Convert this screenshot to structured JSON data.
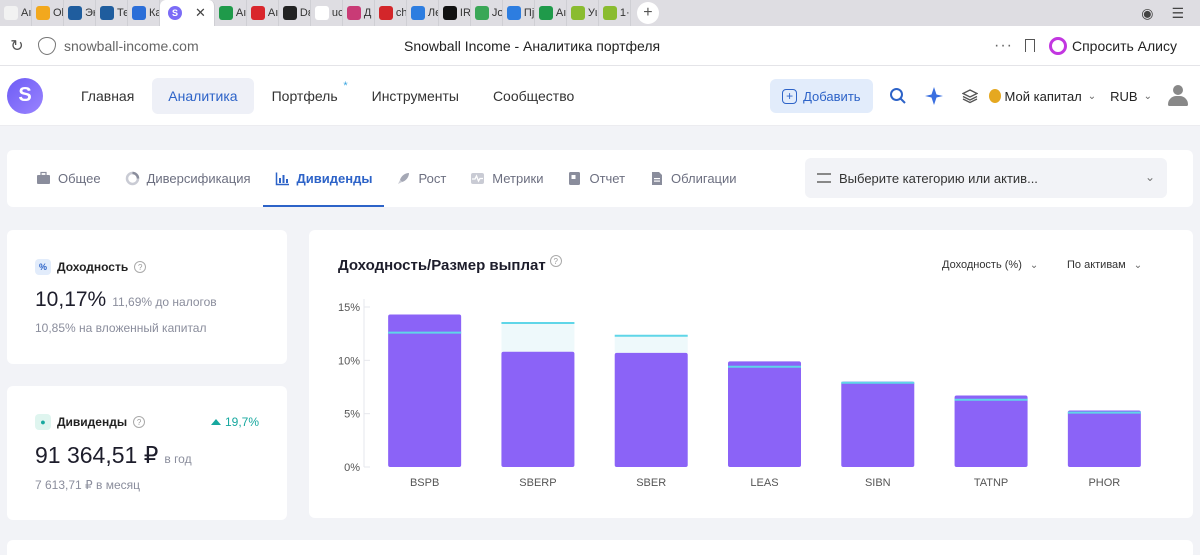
{
  "browser": {
    "tabs": [
      {
        "icon": "a-icon",
        "label": "Aı",
        "color": "#f2f2f2",
        "fg": "#333"
      },
      {
        "icon": "multicolor-icon",
        "label": "Ol",
        "color": "#f2a81d",
        "fg": "#fff"
      },
      {
        "icon": "chart-icon",
        "label": "Эк",
        "color": "#1f5d9e",
        "fg": "#fff"
      },
      {
        "icon": "chart-icon",
        "label": "Те",
        "color": "#1f5d9e",
        "fg": "#fff"
      },
      {
        "icon": "t-icon",
        "label": "Ка",
        "color": "#2b6ed8",
        "fg": "#fff"
      }
    ],
    "active_tab": {
      "icon": "snowball-icon",
      "close": "✕"
    },
    "tabs_after": [
      {
        "icon": "plus-cross-icon",
        "label": "Aı",
        "color": "#1f9a4a",
        "fg": "#fff"
      },
      {
        "icon": "t-icon",
        "label": "Aı",
        "color": "#d9262c",
        "fg": "#fff"
      },
      {
        "icon": "d-icon",
        "label": "Dε",
        "color": "#222",
        "fg": "#fff"
      },
      {
        "icon": "doc-icon",
        "label": "uc",
        "color": "#ffffff",
        "fg": "#555"
      },
      {
        "icon": "photo-icon",
        "label": "Д",
        "color": "#c93b76",
        "fg": "#fff"
      },
      {
        "icon": "pdf-icon",
        "label": "ch",
        "color": "#d3262a",
        "fg": "#fff"
      },
      {
        "icon": "vk-icon",
        "label": "Ле",
        "color": "#2d7de0",
        "fg": "#fff"
      },
      {
        "icon": "tv-icon",
        "label": "IR",
        "color": "#111",
        "fg": "#fff"
      },
      {
        "icon": "drive-icon",
        "label": "Jo",
        "color": "#3aa757",
        "fg": "#fff"
      },
      {
        "icon": "vk-icon",
        "label": "Пј",
        "color": "#2d7de0",
        "fg": "#fff"
      },
      {
        "icon": "plus-cross-icon",
        "label": "Aı",
        "color": "#1f9a4a",
        "fg": "#fff"
      },
      {
        "icon": "sheet-icon",
        "label": "Уι",
        "color": "#8abc30",
        "fg": "#fff"
      },
      {
        "icon": "check-icon",
        "label": "1·",
        "color": "#8abc30",
        "fg": "#fff"
      }
    ],
    "new_tab": "+",
    "url": "snowball-income.com",
    "page_title": "Snowball Income - Аналитика портфеля",
    "alice_label": "Спросить Алису",
    "menu_dots": "···"
  },
  "header": {
    "logo_letter": "S",
    "nav": [
      {
        "label": "Главная",
        "active": false
      },
      {
        "label": "Аналитика",
        "active": true
      },
      {
        "label": "Портфель",
        "active": false,
        "star": "*"
      },
      {
        "label": "Инструменты",
        "active": false
      },
      {
        "label": "Сообщество",
        "active": false
      }
    ],
    "add_label": "Добавить",
    "capital_label": "Мой капитал",
    "currency": "RUB"
  },
  "subtabs": {
    "items": [
      {
        "label": "Общее",
        "icon": "briefcase-icon",
        "active": false
      },
      {
        "label": "Диверсификация",
        "icon": "donut-icon",
        "active": false
      },
      {
        "label": "Дивиденды",
        "icon": "bar-chart-icon",
        "active": true
      },
      {
        "label": "Рост",
        "icon": "rocket-icon",
        "active": false
      },
      {
        "label": "Метрики",
        "icon": "pulse-icon",
        "active": false
      },
      {
        "label": "Отчет",
        "icon": "report-icon",
        "active": false
      },
      {
        "label": "Облигации",
        "icon": "document-icon",
        "active": false
      }
    ],
    "category_placeholder": "Выберите категорию или актив..."
  },
  "yield_card": {
    "title": "Доходность",
    "value": "10,17%",
    "before_tax": "11,69% до налогов",
    "invested": "10,85% на вложенный капитал"
  },
  "dividends_card": {
    "title": "Дивиденды",
    "growth": "19,7%",
    "value": "91 364,51 ₽",
    "period": "в год",
    "monthly": "7 613,71 ₽ в месяц"
  },
  "chart_panel": {
    "title": "Доходность/Размер выплат",
    "metric_select": "Доходность (%)",
    "group_select": "По активам"
  },
  "colors": {
    "bar": "#8b63f7",
    "bar_light": "#eef9fb",
    "marker": "#5fd6e8",
    "accent": "#2d63c8"
  },
  "chart_data": {
    "type": "bar",
    "categories": [
      "BSPB",
      "SBERP",
      "SBER",
      "LEAS",
      "SIBN",
      "TATNP",
      "PHOR"
    ],
    "series": [
      {
        "values": [
          14.3,
          10.8,
          10.7,
          9.9,
          8.0,
          6.7,
          5.3
        ]
      },
      {
        "values": [
          12.6,
          13.5,
          12.3,
          9.4,
          7.9,
          6.3,
          5.1
        ]
      }
    ],
    "yticks": [
      "0%",
      "5%",
      "10%",
      "15%"
    ],
    "ylim": [
      0,
      15
    ]
  }
}
